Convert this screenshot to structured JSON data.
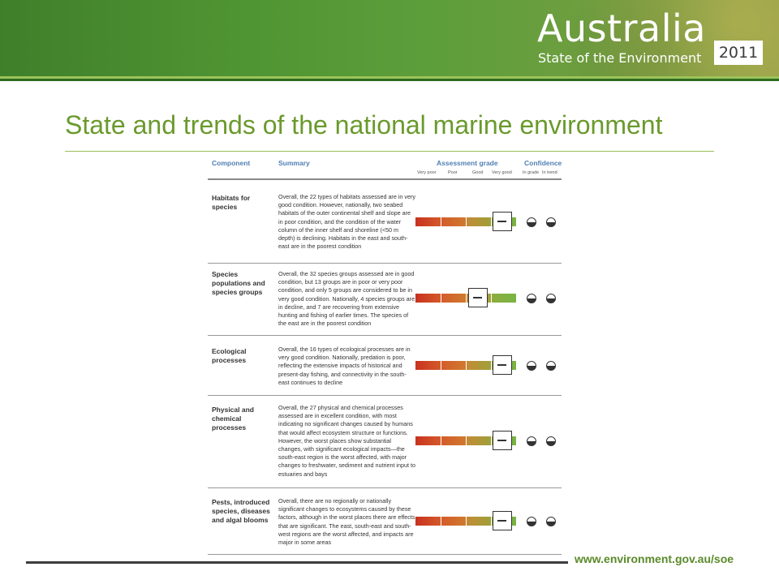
{
  "header": {
    "brand_title": "Australia",
    "brand_subtitle": "State of the Environment",
    "year": "2011"
  },
  "slide": {
    "title": "State and trends of the national marine environment"
  },
  "table": {
    "col_component": "Component",
    "col_summary": "Summary",
    "col_grade": "Assessment grade",
    "col_confidence": "Confidence",
    "grade_scale": [
      "Very poor",
      "Poor",
      "Good",
      "Very good"
    ],
    "confidence_labels": [
      "In grade",
      "In trend"
    ],
    "rows": [
      {
        "component": "Habitats for species",
        "summary": "Overall, the 22 types of habitats assessed are in very good condition. However, nationally, two seabed habitats of the outer continental shelf and slope are in poor condition, and the condition of the water column of the inner shelf and shoreline (<50 m depth) is declining. Habitats in the east and south-east are in the poorest condition",
        "grade": "Very good",
        "grade_position": 0.86
      },
      {
        "component": "Species populations and species groups",
        "summary": "Overall, the 32 species groups assessed are in good condition, but 13 groups are in poor or very poor condition, and only 5 groups are considered to be in very good condition. Nationally, 4 species groups are in decline, and 7 are recovering from extensive hunting and fishing of earlier times. The species of the east are in the poorest condition",
        "grade": "Good",
        "grade_position": 0.62
      },
      {
        "component": "Ecological processes",
        "summary": "Overall, the 16 types of ecological processes are in very good condition. Nationally, predation is poor, reflecting the extensive impacts of historical and present-day fishing, and connectivity in the south-east continues to decline",
        "grade": "Very good",
        "grade_position": 0.86
      },
      {
        "component": "Physical and chemical processes",
        "summary": "Overall, the 27 physical and chemical processes assessed are in excellent condition, with most indicating no significant changes caused by humans that would affect ecosystem structure or functions. However, the worst places show substantial changes, with significant ecological impacts—the south-east region is the worst affected, with major changes to freshwater, sediment and nutrient input to estuaries and bays",
        "grade": "Very good",
        "grade_position": 0.86
      },
      {
        "component": "Pests, introduced species, diseases and algal blooms",
        "summary": "Overall, there are no regionally or nationally significant changes to ecosystems caused by these factors, although in the worst places there are effects that are significant. The east, south-east and south-west regions are the worst affected, and impacts are major in some areas",
        "grade": "Very good",
        "grade_position": 0.86
      }
    ]
  },
  "footer": {
    "url": "www.environment.gov.au/soe"
  }
}
